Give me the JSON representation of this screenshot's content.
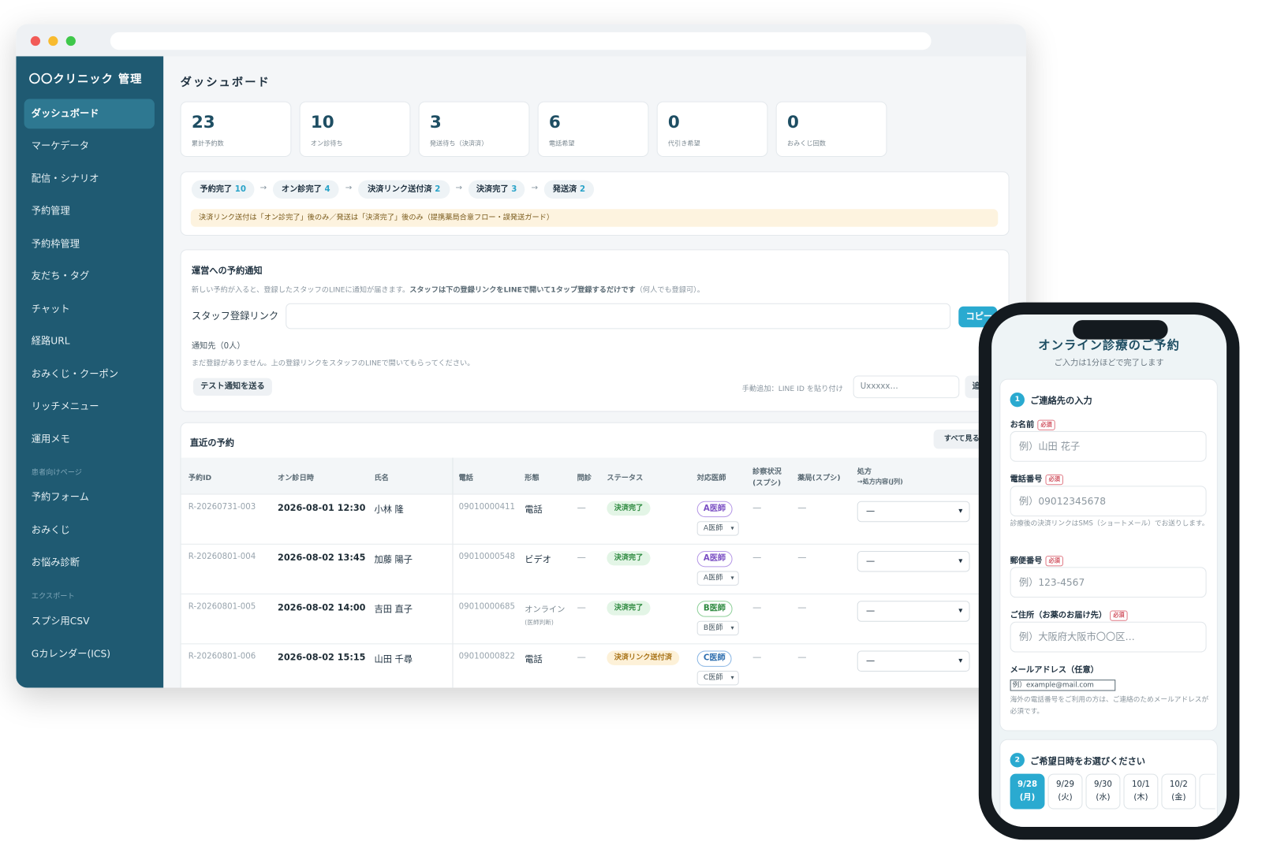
{
  "app": {
    "title": "〇〇クリニック 管理"
  },
  "sidebar": {
    "items": [
      "ダッシュボード",
      "マーケデータ",
      "配信・シナリオ",
      "予約管理",
      "予約枠管理",
      "友だち・タグ",
      "チャット",
      "経路URL",
      "おみくじ・クーポン",
      "リッチメニュー",
      "運用メモ"
    ],
    "patient_section": "患者向けページ",
    "patient_items": [
      "予約フォーム",
      "おみくじ",
      "お悩み診断"
    ],
    "export_section": "エクスポート",
    "export_items": [
      "スプシ用CSV",
      "Gカレンダー(ICS)"
    ]
  },
  "page_title": "ダッシュボード",
  "stats": [
    {
      "value": "23",
      "label": "累計予約数"
    },
    {
      "value": "10",
      "label": "オン診待ち"
    },
    {
      "value": "3",
      "label": "発送待ち（決済済）"
    },
    {
      "value": "6",
      "label": "電話希望"
    },
    {
      "value": "0",
      "label": "代引き希望"
    },
    {
      "value": "0",
      "label": "おみくじ回数"
    }
  ],
  "flow": {
    "steps": [
      {
        "label": "予約完了",
        "count": "10"
      },
      {
        "label": "オン診完了",
        "count": "4"
      },
      {
        "label": "決済リンク送付済",
        "count": "2"
      },
      {
        "label": "決済完了",
        "count": "3"
      },
      {
        "label": "発送済",
        "count": "2"
      }
    ],
    "arrow": "→",
    "note": "決済リンク送付は「オン診完了」後のみ／発送は「決済完了」後のみ（提携薬局合意フロー・誤発送ガード）"
  },
  "notify": {
    "title": "運営への予約通知",
    "desc_a": "新しい予約が入ると、登録したスタッフのLINEに通知が届きます。",
    "desc_b": "スタッフは下の登録リンクをLINEで開いて1タップ登録するだけです",
    "desc_c": "（何人でも登録可）。",
    "link_label": "スタッフ登録リンク",
    "copy_label": "コピー",
    "recipients": "通知先（0人）",
    "empty": "まだ登録がありません。上の登録リンクをスタッフのLINEで開いてもらってください。",
    "test_button": "テスト通知を送る",
    "manual_label": "手動追加：LINE ID を貼り付け",
    "manual_placeholder": "Uxxxxx…",
    "add_button": "追"
  },
  "recent": {
    "title": "直近の予約",
    "view_all": "すべて見る",
    "headers": {
      "id": "予約ID",
      "datetime": "オン診日時",
      "name": "氏名",
      "phone": "電話",
      "type": "形態",
      "interview": "問診",
      "status": "ステータス",
      "doctor": "対応医師",
      "exam": "診察状況",
      "exam_sub": "(スプシ)",
      "pharmacy": "薬局(スプシ)",
      "rx": "処方",
      "rx_sub": "→処方内容(J列)"
    },
    "rows": [
      {
        "id": "R-20260731-003",
        "datetime": "2026-08-01 12:30",
        "name": "小林 隆",
        "phone": "09010000411",
        "type": "電話",
        "type_sub": "",
        "interview": "—",
        "status": "決済完了",
        "doctor": "A医師",
        "doctor_select": "A医師",
        "exam": "—",
        "pharmacy": "—",
        "rx": "—"
      },
      {
        "id": "R-20260801-004",
        "datetime": "2026-08-02 13:45",
        "name": "加藤 陽子",
        "phone": "09010000548",
        "type": "ビデオ",
        "type_sub": "",
        "interview": "—",
        "status": "決済完了",
        "doctor": "A医師",
        "doctor_select": "A医師",
        "exam": "—",
        "pharmacy": "—",
        "rx": "—"
      },
      {
        "id": "R-20260801-005",
        "datetime": "2026-08-02 14:00",
        "name": "吉田 直子",
        "phone": "09010000685",
        "type": "オンライン",
        "type_sub": "(医師判断)",
        "interview": "—",
        "status": "決済完了",
        "doctor": "B医師",
        "doctor_select": "B医師",
        "exam": "—",
        "pharmacy": "—",
        "rx": "—"
      },
      {
        "id": "R-20260801-006",
        "datetime": "2026-08-02 15:15",
        "name": "山田 千尋",
        "phone": "09010000822",
        "type": "電話",
        "type_sub": "",
        "interview": "—",
        "status": "決済リンク送付済",
        "doctor": "C医師",
        "doctor_select": "C医師",
        "exam": "—",
        "pharmacy": "—",
        "rx": "—"
      }
    ]
  },
  "phone": {
    "title": "オンライン診療のご予約",
    "subtitle": "ご入力は1分ほどで完了します",
    "section1": {
      "num": "1",
      "title": "ご連絡先の入力"
    },
    "required": "必須",
    "fields": {
      "name": {
        "label": "お名前",
        "placeholder": "例）山田 花子"
      },
      "tel": {
        "label": "電話番号",
        "placeholder": "例）09012345678",
        "hint": "診療後の決済リンクはSMS（ショートメール）でお送りします。"
      },
      "zip": {
        "label": "郵便番号",
        "placeholder": "例）123-4567"
      },
      "address": {
        "label": "ご住所（お薬のお届け先）",
        "placeholder": "例）大阪府大阪市〇〇区…"
      },
      "email": {
        "label": "メールアドレス（任意）",
        "placeholder": "例）example@mail.com",
        "hint": "海外の電話番号をご利用の方は、ご連絡のためメールアドレスが必須です。"
      }
    },
    "section2": {
      "num": "2",
      "title": "ご希望日時をお選びください"
    },
    "dates": [
      {
        "d": "9/28",
        "w": "(月)"
      },
      {
        "d": "9/29",
        "w": "(火)"
      },
      {
        "d": "9/30",
        "w": "(水)"
      },
      {
        "d": "10/1",
        "w": "(木)"
      },
      {
        "d": "10/2",
        "w": "(金)"
      }
    ]
  },
  "colors": {
    "sidebar": "#1f5a72",
    "accent": "#2aaad0",
    "done": "#2e8a40",
    "link": "#a87318"
  }
}
